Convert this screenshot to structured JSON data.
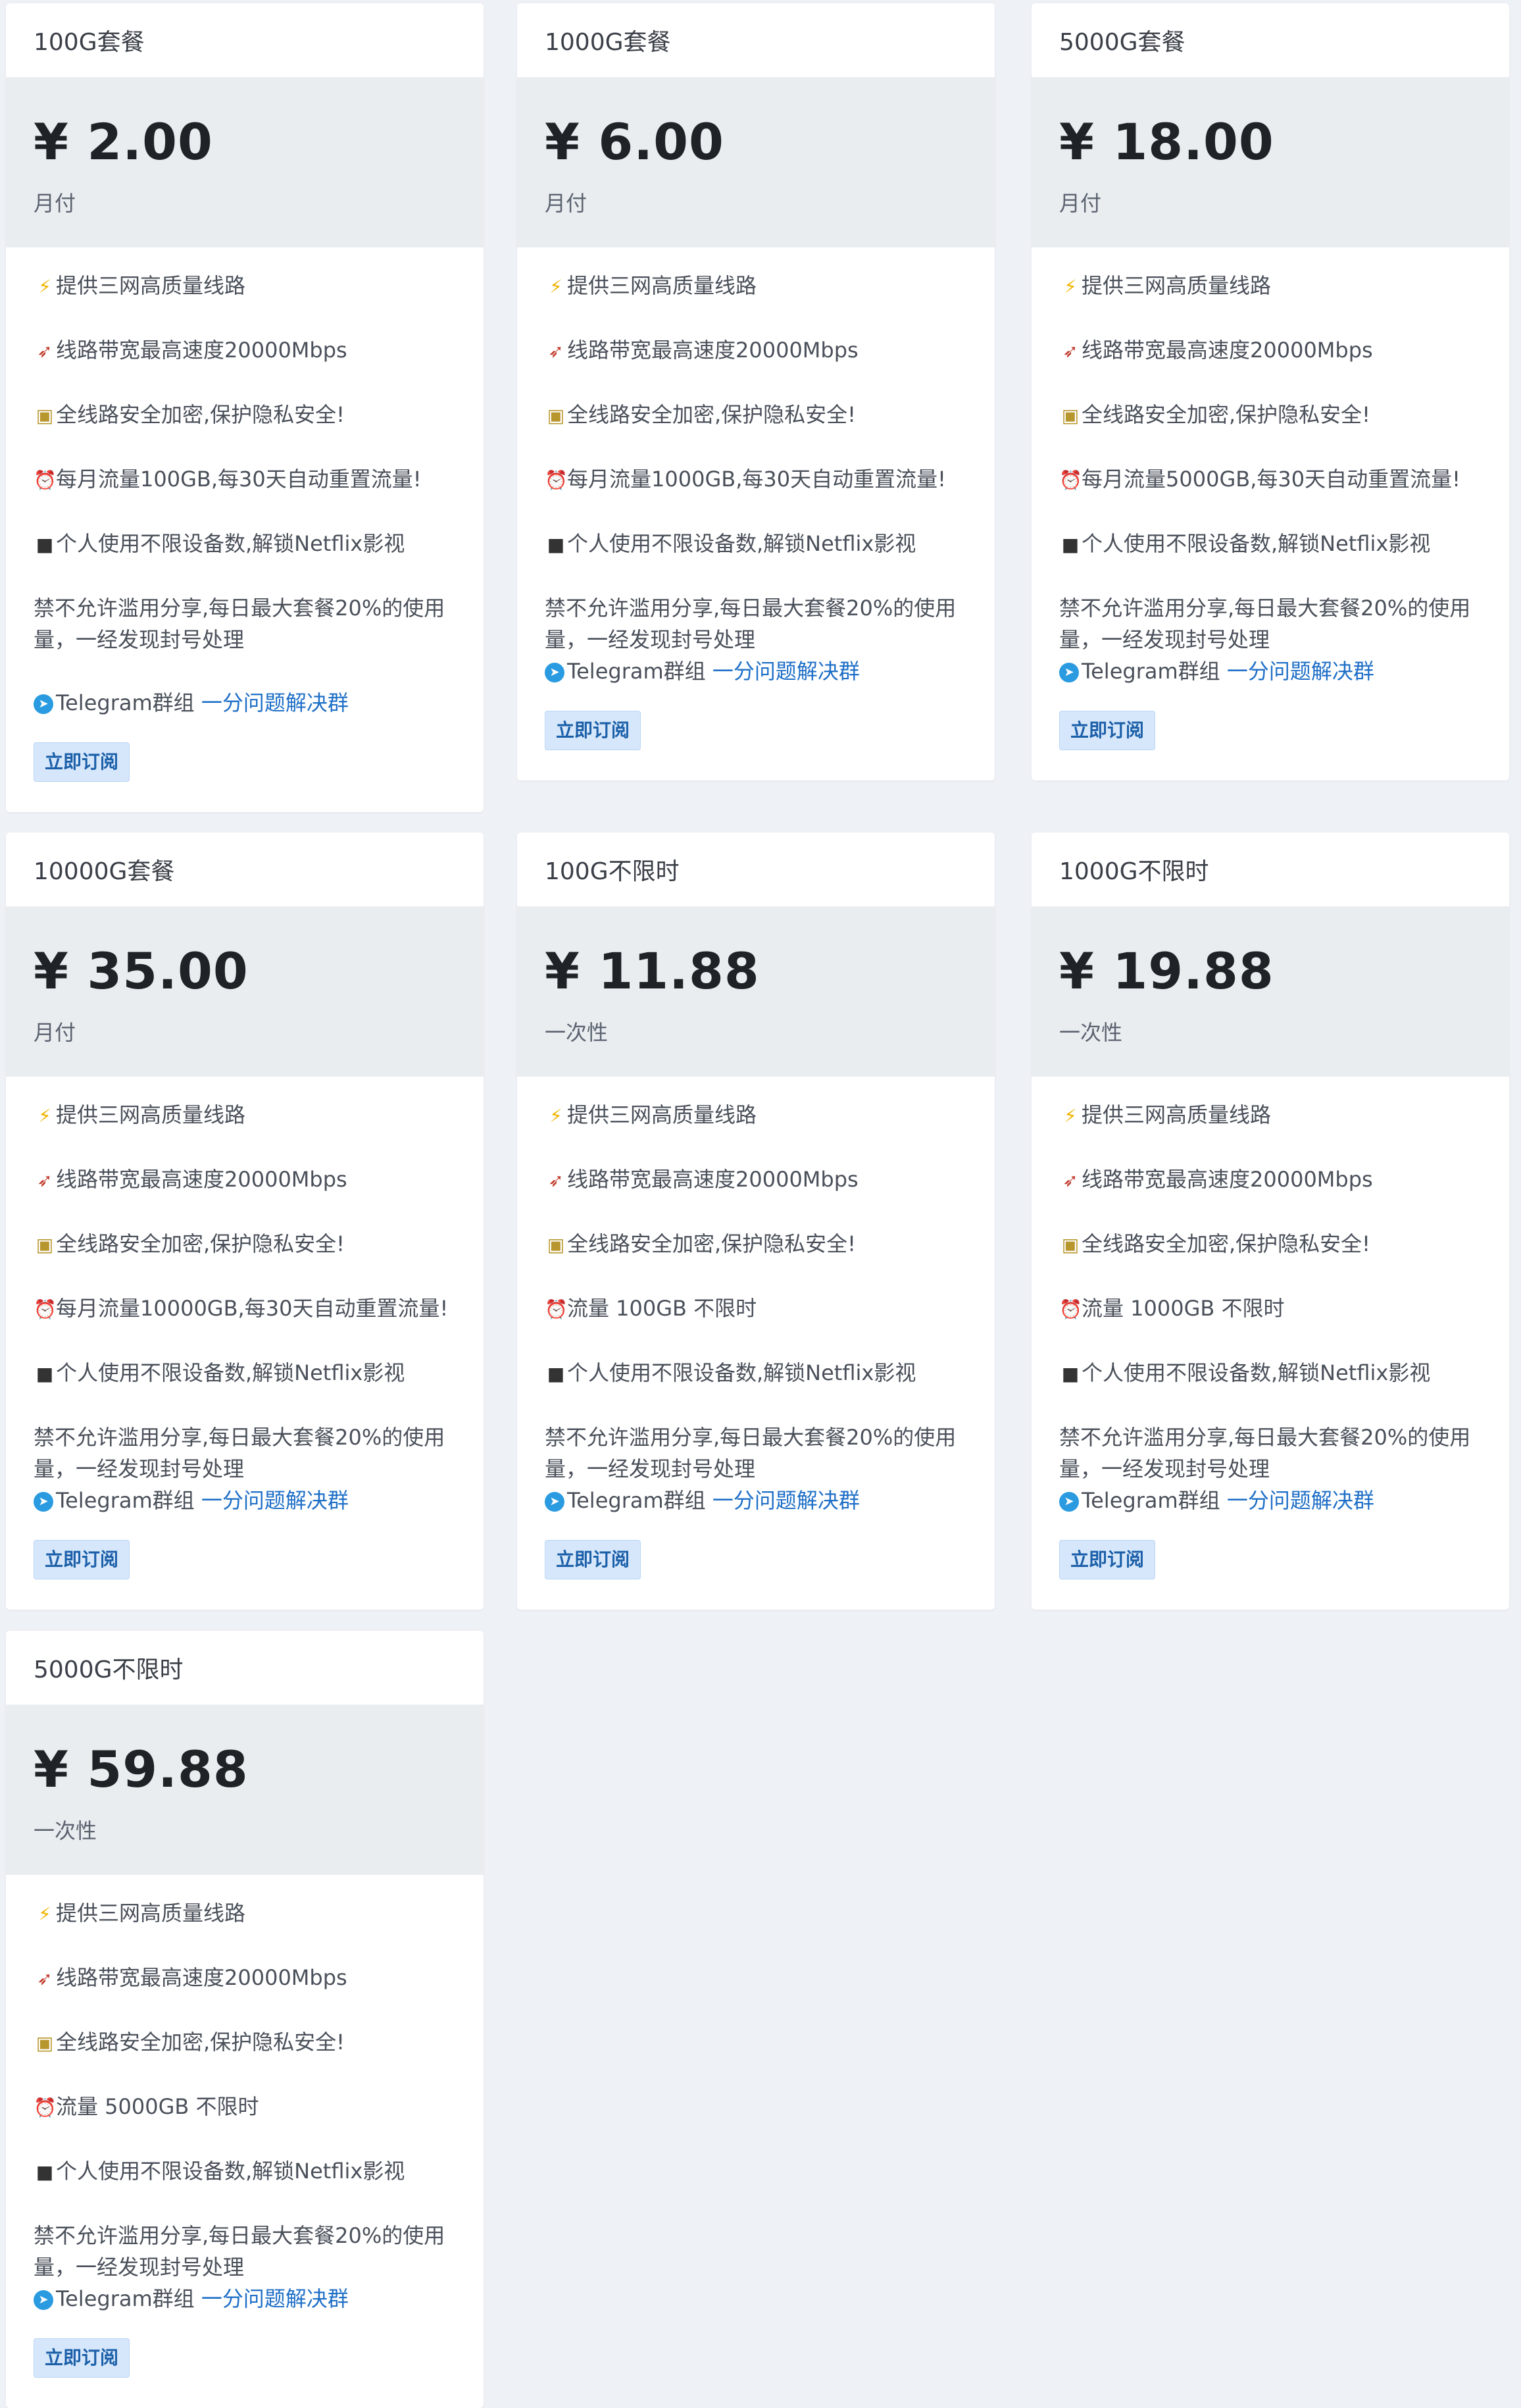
{
  "plans": [
    {
      "name": "100G套餐",
      "price": "¥ 2.00",
      "period": "月付",
      "features": [
        "提供三网高质量线路",
        "线路带宽最高速度20000Mbps",
        "全线路安全加密,保护隐私安全!",
        "每月流量100GB,每30天自动重置流量!",
        "个人使用不限设备数,解锁Netflix影视",
        "禁不允许滥用分享,每日最大套餐20%的使用量，一经发现封号处理"
      ],
      "tg_label": "Telegram群组",
      "tg_link": "一分问题解决群",
      "button": "立即订阅"
    },
    {
      "name": "1000G套餐",
      "price": "¥ 6.00",
      "period": "月付",
      "features": [
        "提供三网高质量线路",
        "线路带宽最高速度20000Mbps",
        "全线路安全加密,保护隐私安全!",
        "每月流量1000GB,每30天自动重置流量!",
        "个人使用不限设备数,解锁Netflix影视",
        "禁不允许滥用分享,每日最大套餐20%的使用量，一经发现封号处理"
      ],
      "tg_label": "Telegram群组",
      "tg_link": "一分问题解决群",
      "button": "立即订阅"
    },
    {
      "name": "5000G套餐",
      "price": "¥ 18.00",
      "period": "月付",
      "features": [
        "提供三网高质量线路",
        "线路带宽最高速度20000Mbps",
        "全线路安全加密,保护隐私安全!",
        "每月流量5000GB,每30天自动重置流量!",
        "个人使用不限设备数,解锁Netflix影视",
        "禁不允许滥用分享,每日最大套餐20%的使用量，一经发现封号处理"
      ],
      "tg_label": "Telegram群组",
      "tg_link": "一分问题解决群",
      "button": "立即订阅"
    },
    {
      "name": "10000G套餐",
      "price": "¥ 35.00",
      "period": "月付",
      "features": [
        "提供三网高质量线路",
        "线路带宽最高速度20000Mbps",
        "全线路安全加密,保护隐私安全!",
        "每月流量10000GB,每30天自动重置流量!",
        "个人使用不限设备数,解锁Netflix影视",
        "禁不允许滥用分享,每日最大套餐20%的使用量，一经发现封号处理"
      ],
      "tg_label": "Telegram群组",
      "tg_link": "一分问题解决群",
      "button": "立即订阅"
    },
    {
      "name": "100G不限时",
      "price": "¥ 11.88",
      "period": "一次性",
      "features": [
        "提供三网高质量线路",
        "线路带宽最高速度20000Mbps",
        "全线路安全加密,保护隐私安全!",
        "流量 100GB 不限时",
        "个人使用不限设备数,解锁Netflix影视",
        "禁不允许滥用分享,每日最大套餐20%的使用量，一经发现封号处理"
      ],
      "tg_label": "Telegram群组",
      "tg_link": "一分问题解决群",
      "button": "立即订阅"
    },
    {
      "name": "1000G不限时",
      "price": "¥ 19.88",
      "period": "一次性",
      "features": [
        "提供三网高质量线路",
        "线路带宽最高速度20000Mbps",
        "全线路安全加密,保护隐私安全!",
        "流量 1000GB 不限时",
        "个人使用不限设备数,解锁Netflix影视",
        "禁不允许滥用分享,每日最大套餐20%的使用量，一经发现封号处理"
      ],
      "tg_label": "Telegram群组",
      "tg_link": "一分问题解决群",
      "button": "立即订阅"
    },
    {
      "name": "5000G不限时",
      "price": "¥ 59.88",
      "period": "一次性",
      "features": [
        "提供三网高质量线路",
        "线路带宽最高速度20000Mbps",
        "全线路安全加密,保护隐私安全!",
        "流量 5000GB 不限时",
        "个人使用不限设备数,解锁Netflix影视",
        "禁不允许滥用分享,每日最大套餐20%的使用量，一经发现封号处理"
      ],
      "tg_label": "Telegram群组",
      "tg_link": "一分问题解决群",
      "button": "立即订阅"
    }
  ],
  "feature_icons": [
    "lightning-icon",
    "rocket-icon",
    "lock-icon",
    "alarm-clock-icon",
    "video-camera-icon",
    "forbidden-icon"
  ]
}
